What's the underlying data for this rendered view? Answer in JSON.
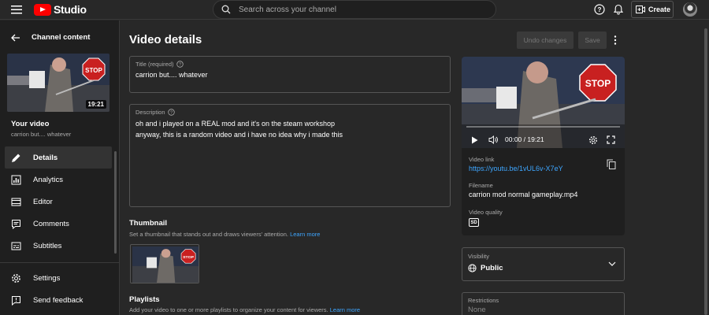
{
  "topbar": {
    "logo_text": "Studio",
    "search_placeholder": "Search across your channel",
    "create_label": "Create"
  },
  "sidebar": {
    "back_label": "Channel content",
    "thumbnail_duration": "19:21",
    "your_video_label": "Your video",
    "video_title_short": "carrion but.... whatever",
    "items": [
      {
        "label": "Details",
        "icon": "pencil-icon",
        "active": true
      },
      {
        "label": "Analytics",
        "icon": "analytics-icon"
      },
      {
        "label": "Editor",
        "icon": "editor-icon"
      },
      {
        "label": "Comments",
        "icon": "comments-icon"
      },
      {
        "label": "Subtitles",
        "icon": "subtitles-icon"
      }
    ],
    "bottom_items": [
      {
        "label": "Settings",
        "icon": "gear-icon"
      },
      {
        "label": "Send feedback",
        "icon": "feedback-icon"
      }
    ]
  },
  "main": {
    "page_title": "Video details",
    "undo_label": "Undo changes",
    "save_label": "Save",
    "title_field": {
      "label": "Title (required)",
      "value": "carrion but.... whatever"
    },
    "description_field": {
      "label": "Description",
      "lines": [
        "oh and i played on a REAL mod and it's on the steam workshop",
        "anyway, this is a random video and i have no idea why i made this"
      ]
    },
    "thumbnail": {
      "title": "Thumbnail",
      "subtitle": "Set a thumbnail that stands out and draws viewers' attention.",
      "learn_more": "Learn more"
    },
    "playlists": {
      "title": "Playlists",
      "subtitle": "Add your video to one or more playlists to organize your content for viewers.",
      "learn_more": "Learn more"
    }
  },
  "video_panel": {
    "time": "00:00 / 19:21",
    "video_link_label": "Video link",
    "video_link": "https://youtu.be/1vUL6v-X7eY",
    "filename_label": "Filename",
    "filename": "carrion mod normal gameplay.mp4",
    "quality_label": "Video quality",
    "quality_badge": "SD",
    "visibility_label": "Visibility",
    "visibility_value": "Public",
    "restrictions_label": "Restrictions",
    "restrictions_value": "None"
  },
  "colors": {
    "background": "#282828",
    "sidebar": "#1f1f1f",
    "link": "#3ea6ff",
    "brand_red": "#ff0000"
  }
}
